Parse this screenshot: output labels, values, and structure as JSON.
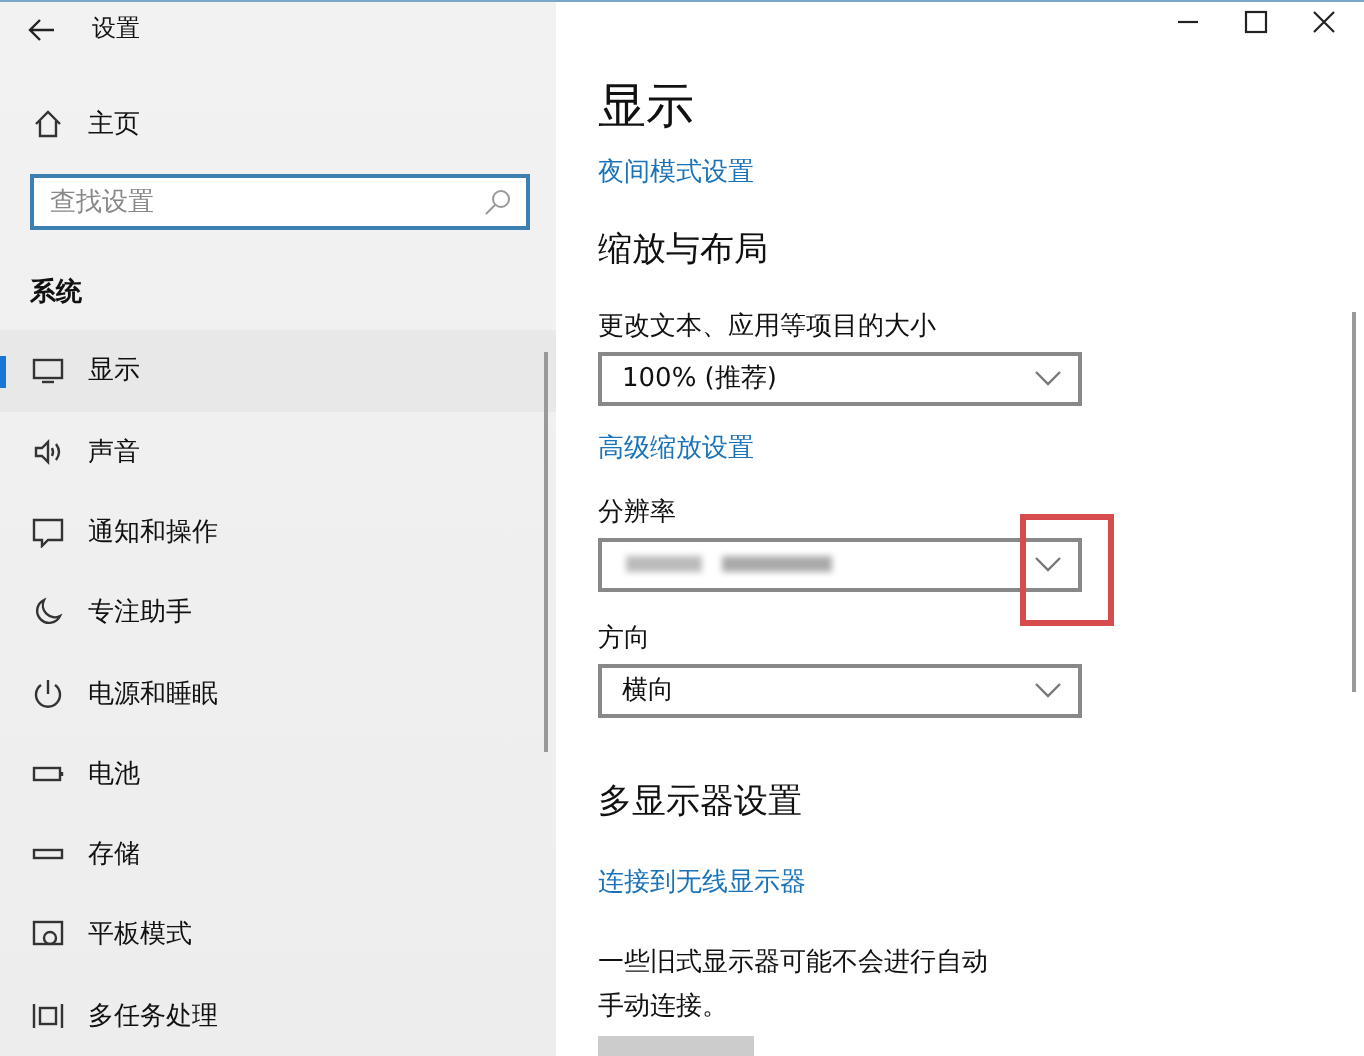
{
  "window": {
    "title": "设置"
  },
  "sidebar": {
    "home": "主页",
    "search": {
      "placeholder": "查找设置"
    },
    "section": "系统",
    "items": [
      {
        "label": "显示",
        "selected": true
      },
      {
        "label": "声音",
        "selected": false
      },
      {
        "label": "通知和操作",
        "selected": false
      },
      {
        "label": "专注助手",
        "selected": false
      },
      {
        "label": "电源和睡眠",
        "selected": false
      },
      {
        "label": "电池",
        "selected": false
      },
      {
        "label": "存储",
        "selected": false
      },
      {
        "label": "平板模式",
        "selected": false
      },
      {
        "label": "多任务处理",
        "selected": false
      }
    ]
  },
  "content": {
    "title": "显示",
    "blocks": [
      {
        "kind": "link",
        "text": "夜间模式设置"
      },
      {
        "kind": "heading",
        "text": "缩放与布局"
      },
      {
        "kind": "label",
        "text": "更改文本、应用等项目的大小"
      },
      {
        "kind": "dropdown",
        "value": "100% (推荐)"
      },
      {
        "kind": "link",
        "text": "高级缩放设置"
      },
      {
        "kind": "label",
        "text": "分辨率"
      },
      {
        "kind": "dropdown",
        "blurred": true,
        "highlighted": true
      },
      {
        "kind": "label",
        "text": "方向"
      },
      {
        "kind": "dropdown",
        "value": "横向"
      },
      {
        "kind": "heading",
        "text": "多显示器设置"
      },
      {
        "kind": "link",
        "text": "连接到无线显示器"
      },
      {
        "kind": "paragraph",
        "lines": [
          "一些旧式显示器可能不会进行自动",
          "手动连接。"
        ]
      },
      {
        "kind": "button"
      }
    ]
  }
}
